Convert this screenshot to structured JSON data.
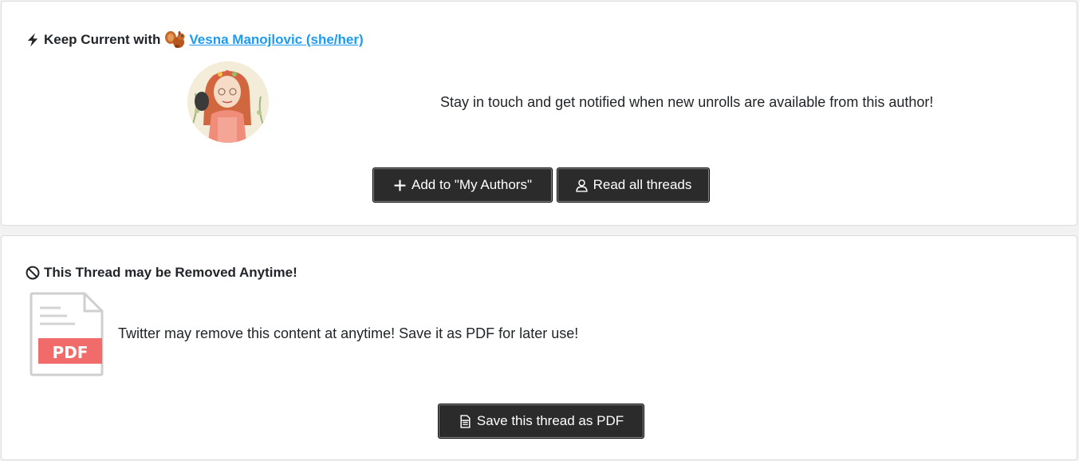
{
  "keep_card": {
    "title_prefix": "Keep Current with",
    "author_name": "Vesna Manojlovic (she/her)",
    "description": "Stay in touch and get notified when new unrolls are available from this author!",
    "add_button_label": "Add to \"My Authors\"",
    "read_button_label": "Read all threads"
  },
  "remove_card": {
    "title": "This Thread may be Removed Anytime!",
    "description": "Twitter may remove this content at anytime! Save it as PDF for later use!",
    "file_badge": "PDF",
    "save_button_label": "Save this thread as PDF"
  },
  "colors": {
    "link": "#1d9bf0",
    "button_bg": "#2b2b2b",
    "pdf_badge": "#f26b6b"
  },
  "icons": {
    "title_keep": "lightning-bolt-icon",
    "author_emoji": "squirrel-icon",
    "add": "plus-icon",
    "read": "person-icon",
    "title_remove": "prohibited-icon",
    "file": "pdf-file-icon",
    "save": "pdf-icon"
  }
}
